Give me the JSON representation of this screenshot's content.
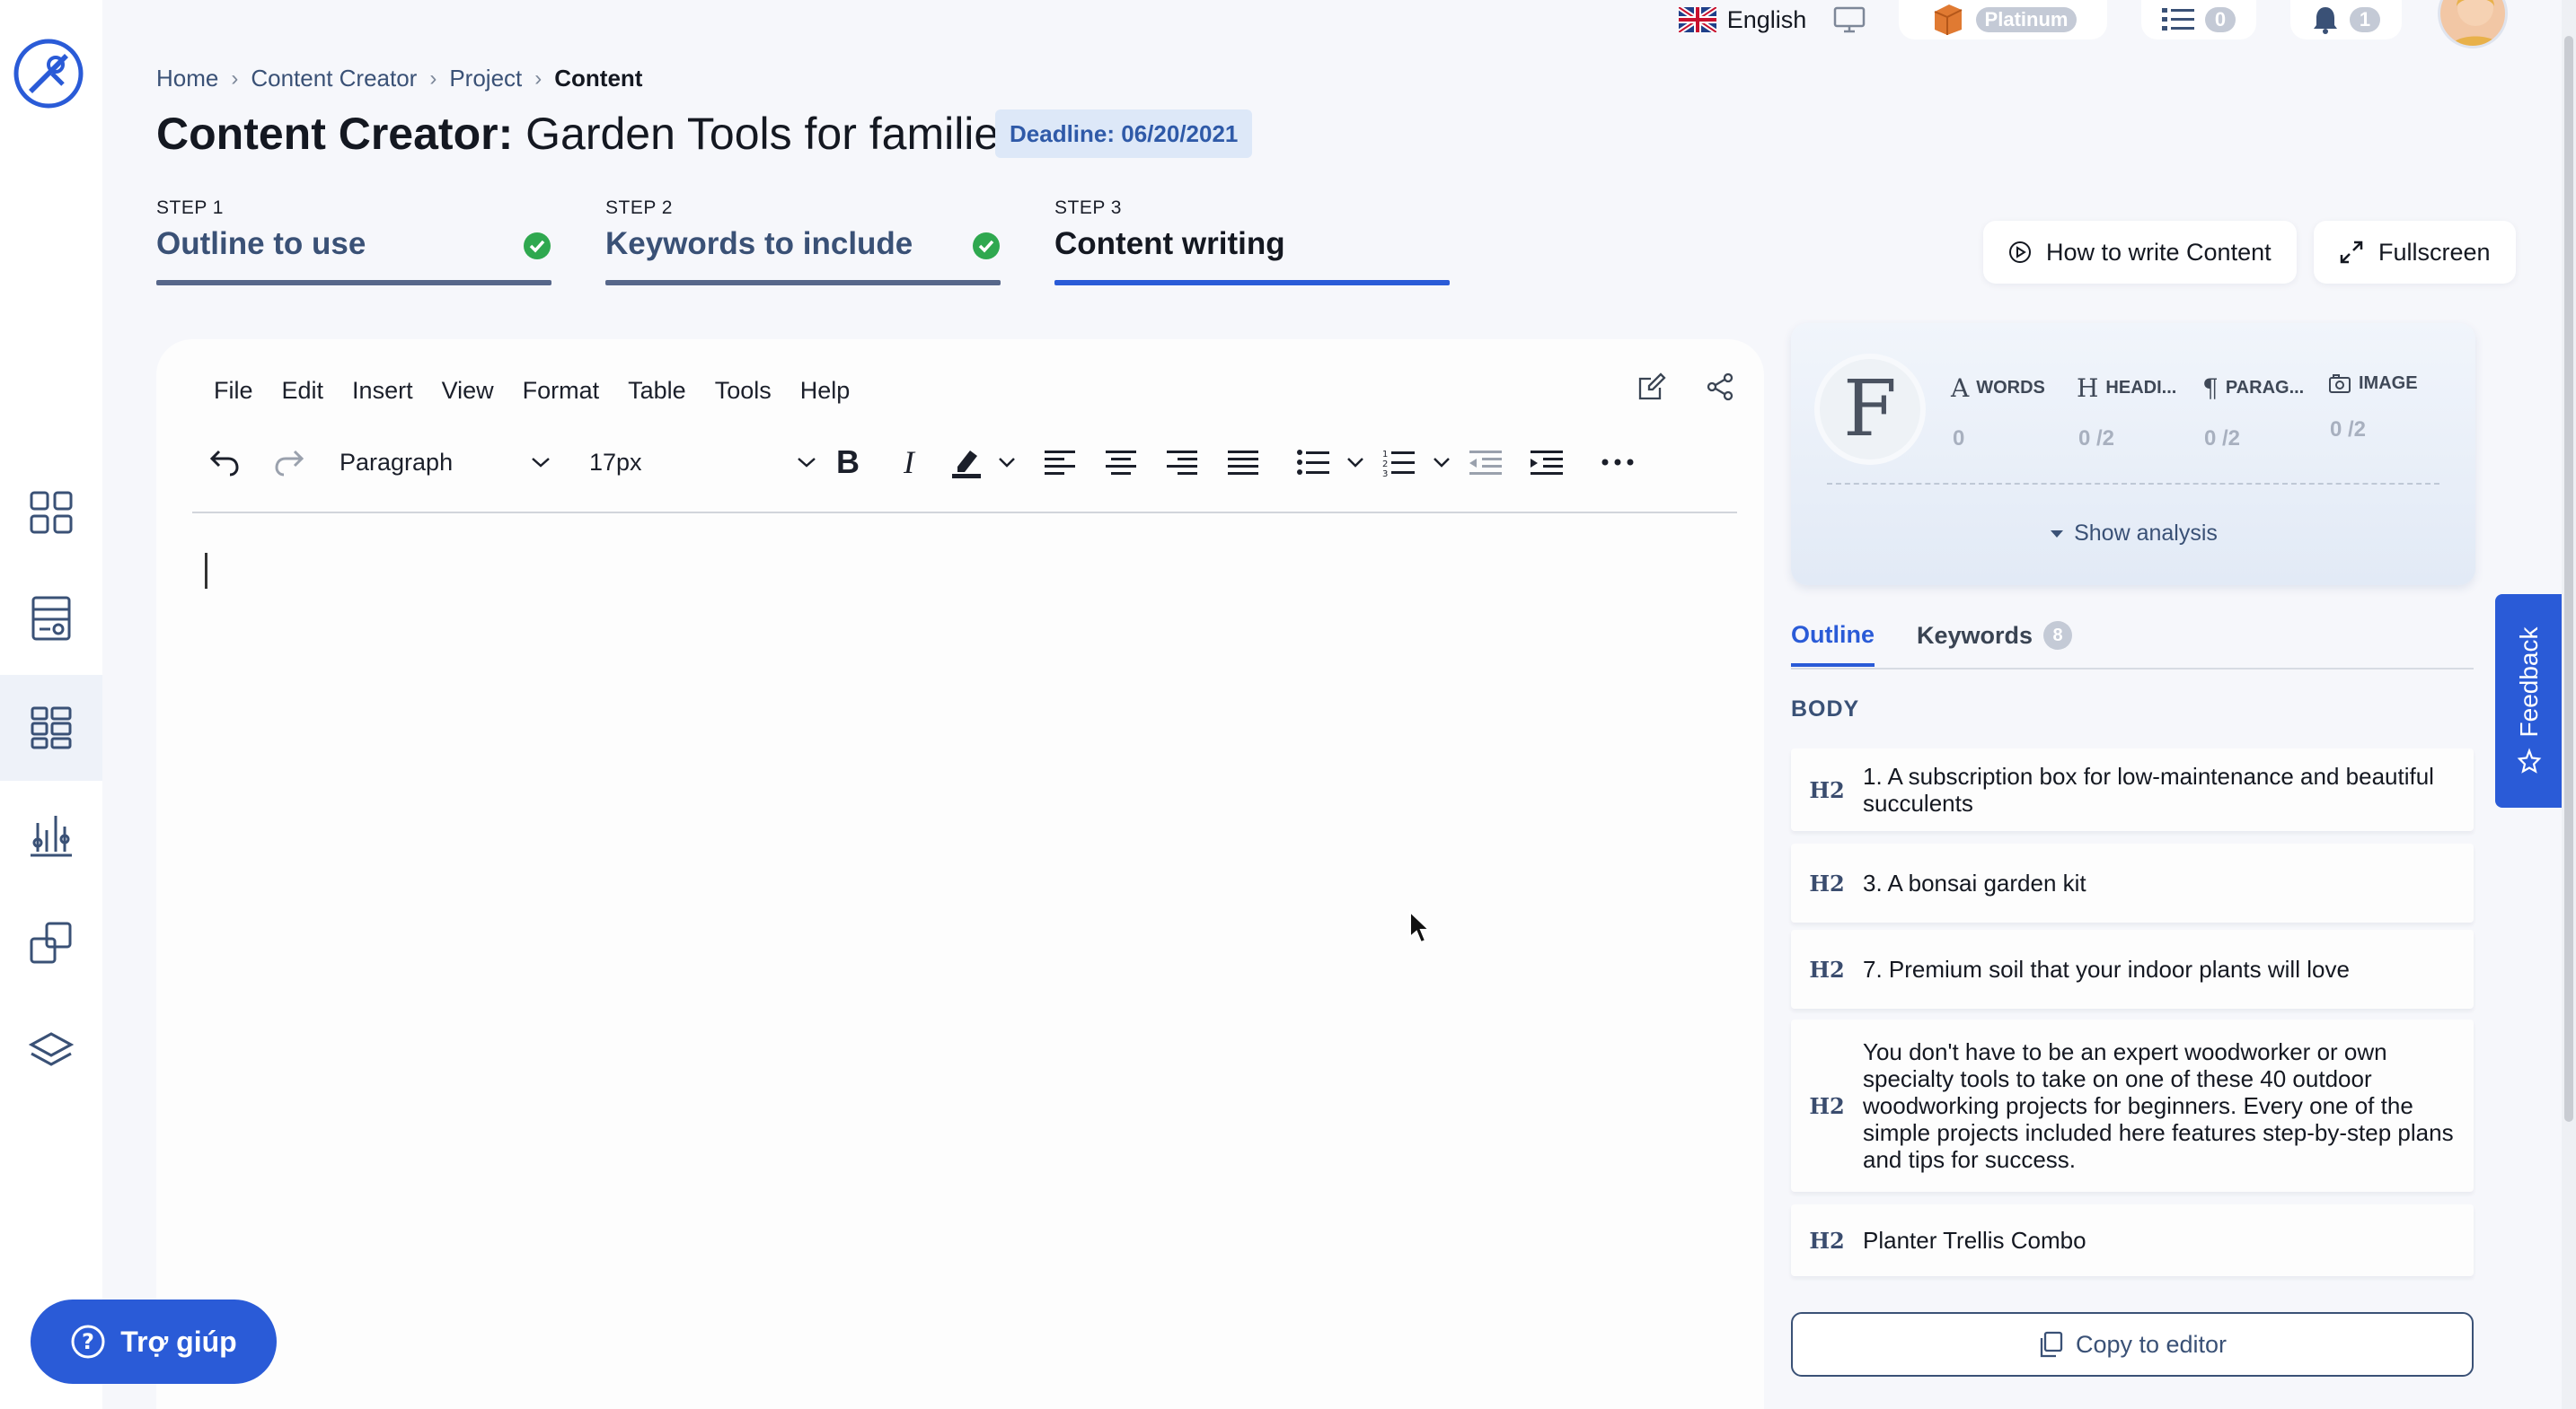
{
  "topbar": {
    "language": "English",
    "plan": "Platinum",
    "tasks_count": "0",
    "notifications_count": "1"
  },
  "breadcrumb": [
    "Home",
    "Content Creator",
    "Project",
    "Content"
  ],
  "page": {
    "title_bold": "Content Creator:",
    "title_rest": "Garden Tools for families",
    "deadline": "Deadline: 06/20/2021"
  },
  "steps": [
    {
      "label": "STEP 1",
      "name": "Outline to use",
      "done": true
    },
    {
      "label": "STEP 2",
      "name": "Keywords to include",
      "done": true
    },
    {
      "label": "STEP 3",
      "name": "Content writing",
      "done": false
    }
  ],
  "actions": {
    "how_to": "How to write Content",
    "fullscreen": "Fullscreen"
  },
  "editor": {
    "menu": [
      "File",
      "Edit",
      "Insert",
      "View",
      "Format",
      "Table",
      "Tools",
      "Help"
    ],
    "block_format": "Paragraph",
    "font_size": "17px"
  },
  "stats": {
    "avatar_letter": "F",
    "items": [
      {
        "label": "WORDS",
        "value": "0"
      },
      {
        "label": "HEADI...",
        "value": "0 /2"
      },
      {
        "label": "PARAG...",
        "value": "0 /2"
      },
      {
        "label": "IMAGE",
        "value": "0 /2"
      }
    ],
    "show_analysis": "Show analysis"
  },
  "tabs": {
    "outline": "Outline",
    "keywords": "Keywords",
    "keywords_count": "8"
  },
  "outline": {
    "section": "BODY",
    "items": [
      {
        "tag": "H2",
        "text": "1. A subscription box for low-maintenance and beautiful succulents"
      },
      {
        "tag": "H2",
        "text": "3. A bonsai garden kit"
      },
      {
        "tag": "H2",
        "text": "7. Premium soil that your indoor plants will love"
      },
      {
        "tag": "H2",
        "text": "You don't have to be an expert woodworker or own specialty tools to take on one of these 40 outdoor woodworking projects for beginners. Every one of the simple projects included here features step-by-step plans and tips for success."
      },
      {
        "tag": "H2",
        "text": "Planter Trellis Combo"
      }
    ],
    "copy_button": "Copy to editor"
  },
  "feedback": "Feedback",
  "help": "Trợ giúp",
  "colors": {
    "accent": "#2a5bd7",
    "navy": "#3a5176",
    "check": "#2fa84f"
  }
}
